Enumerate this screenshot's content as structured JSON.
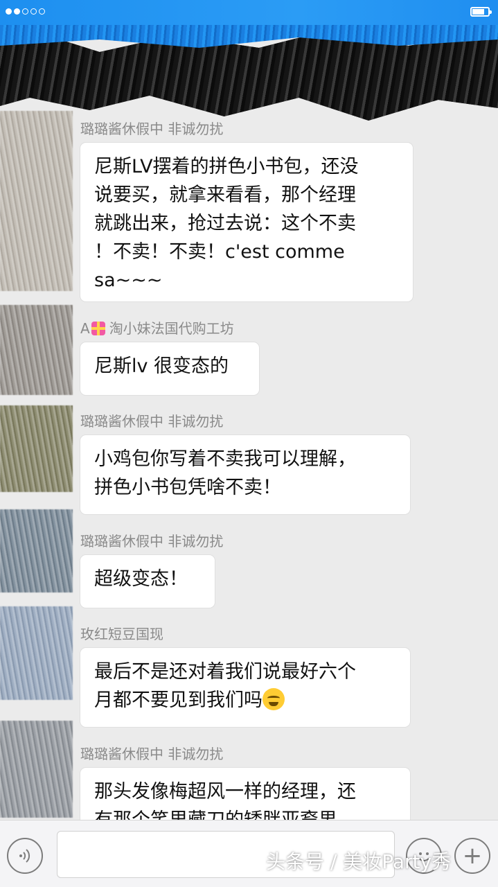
{
  "status_bar": {
    "signal_dots_filled": 2,
    "signal_dots_total": 5
  },
  "messages": [
    {
      "sender": "璐璐酱休假中 非诚勿扰",
      "text": "尼斯LV摆着的拼色小书包，还没\n说要买，就拿来看看，那个经理\n就跳出来，抢过去说：这个不卖\n！不卖！不卖！c'est comme\nsa~~~"
    },
    {
      "sender_prefix": "A",
      "sender": "淘小妹法国代购工坊",
      "text": "尼斯lv 很变态的"
    },
    {
      "sender": "璐璐酱休假中 非诚勿扰",
      "text": "小鸡包你写着不卖我可以理解，\n拼色小书包凭啥不卖！"
    },
    {
      "sender": "璐璐酱休假中 非诚勿扰",
      "text": "超级变态！"
    },
    {
      "sender": "玫红短豆国现",
      "text": "最后不是还对着我们说最好六个\n月都不要见到我们吗"
    },
    {
      "sender": "璐璐酱休假中 非诚勿扰",
      "text": "那头发像梅超风一样的经理，还\n有那个笑里藏刀的矮胖亚裔男"
    }
  ],
  "input_bar": {
    "voice_icon": "voice-wave-icon",
    "emoji_icon": "smiley-icon",
    "plus_icon": "plus-icon",
    "plus_symbol": "+"
  },
  "watermark": "头条号 / 美妆Party秀",
  "colors": {
    "status_bar": "#1d8ff0",
    "background": "#ebebeb",
    "bubble": "#ffffff",
    "sender_text": "#8a8a8a"
  }
}
